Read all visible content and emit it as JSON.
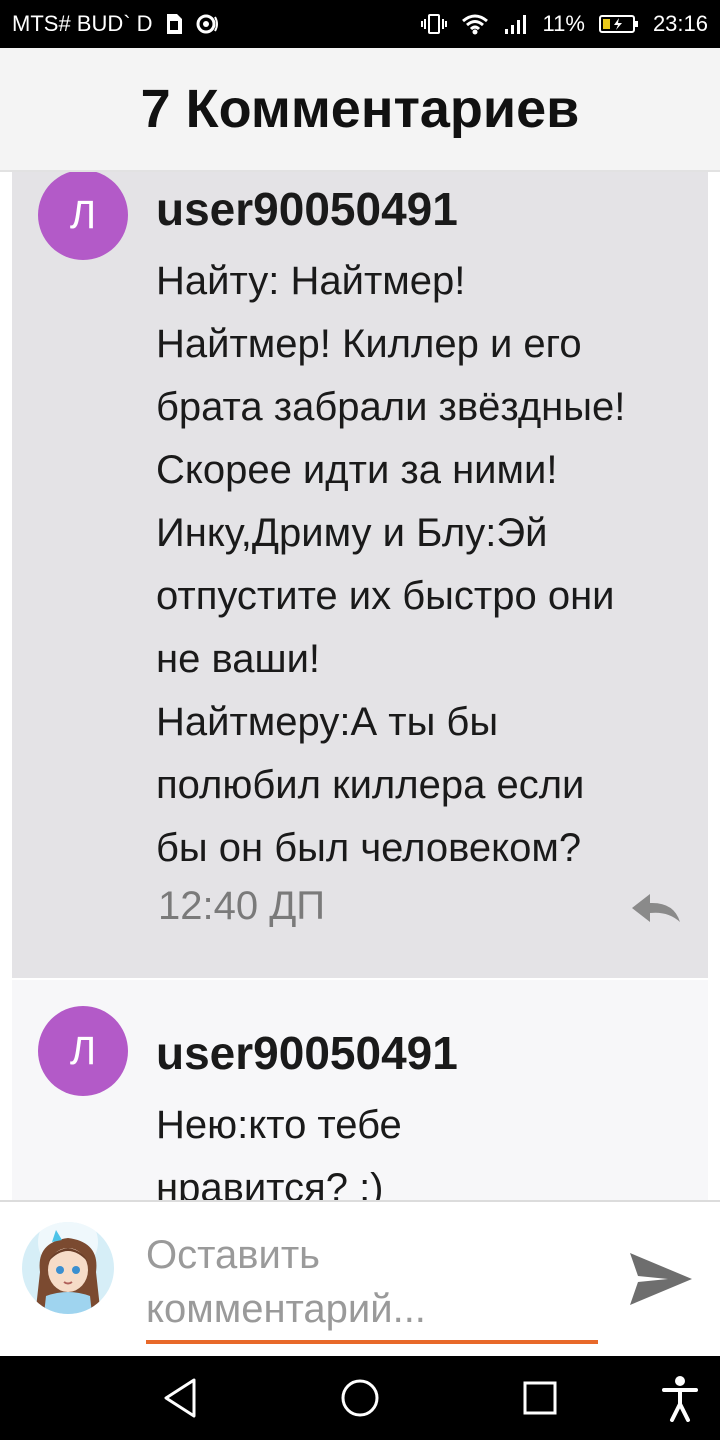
{
  "status_bar": {
    "carrier": "MTS# BUD` D",
    "battery": "11%",
    "time": "23:16"
  },
  "header": {
    "title": "7 Комментариев"
  },
  "comments": [
    {
      "avatar_letter": "Л",
      "username": "user90050491",
      "text": "Найту: Найтмер!\nНайтмер! Киллер и его\nбрата забрали звёздные!\nСкорее идти за ними!\nИнку,Дриму и Блу:Эй\nотпустите их быстро они\nне ваши!\nНайтмеру:А ты бы\nполюбил киллера если\nбы он был человеком?",
      "time": "12:40 ДП"
    },
    {
      "avatar_letter": "Л",
      "username": "user90050491",
      "text": "Нею:кто тебе\nнравится? :)"
    }
  ],
  "compose": {
    "placeholder": "Оставить комментарий..."
  },
  "colors": {
    "avatar": "#b35ac8",
    "input_underline": "#e8692a",
    "selected_bg": "#e4e3e6"
  },
  "icons": {
    "send": "send-icon",
    "reply": "reply-icon",
    "nav_back": "back-triangle-icon",
    "nav_home": "home-circle-icon",
    "nav_recents": "recents-square-icon",
    "accessibility": "accessibility-icon"
  }
}
